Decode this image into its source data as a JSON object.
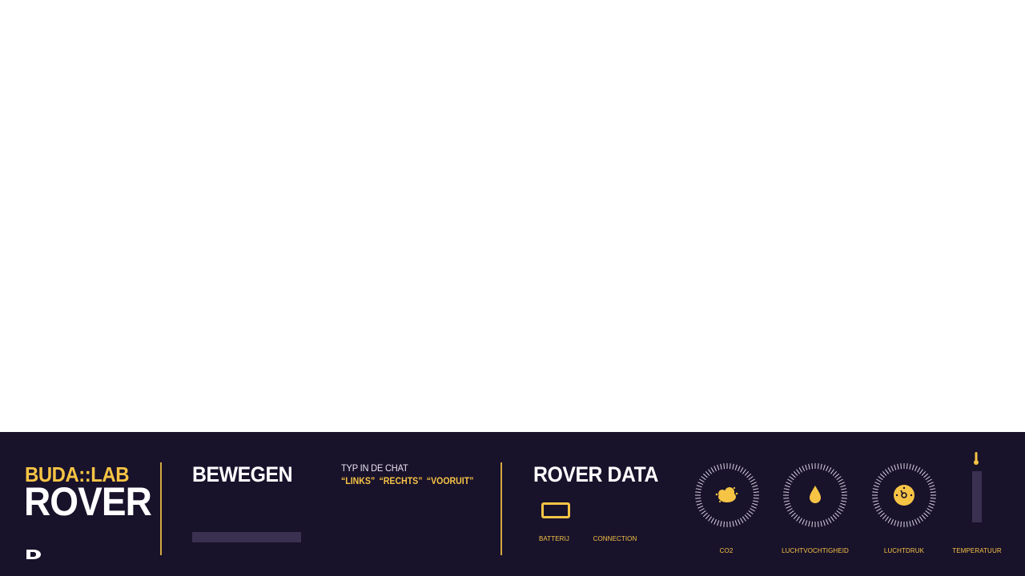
{
  "brand": {
    "top": "BUDA::LAB",
    "main": "ROVER"
  },
  "move": {
    "title": "BEWEGEN",
    "chat_label": "TYP IN DE CHAT",
    "commands": [
      "“LINKS”",
      "“RECHTS”",
      "“VOORUIT”"
    ]
  },
  "rover_data": {
    "title": "ROVER DATA",
    "battery_label": "BATTERIJ",
    "connection_label": "CONNECTION"
  },
  "sensors": {
    "co2_label": "CO2",
    "humidity_label": "LUCHTVOCHTIGHEID",
    "pressure_label": "LUCHTDRUK",
    "temperature_label": "TEMPERATUUR"
  },
  "icons": {
    "logo": "d-logo-icon",
    "battery": "battery-icon",
    "co2": "cloud-icon",
    "humidity": "water-drop-icon",
    "pressure": "pressure-dial-icon",
    "temperature": "thermometer-icon"
  },
  "colors": {
    "panel": "#19122b",
    "accent": "#f6c445",
    "track": "#3a3150",
    "tick": "#d9d5e3"
  }
}
